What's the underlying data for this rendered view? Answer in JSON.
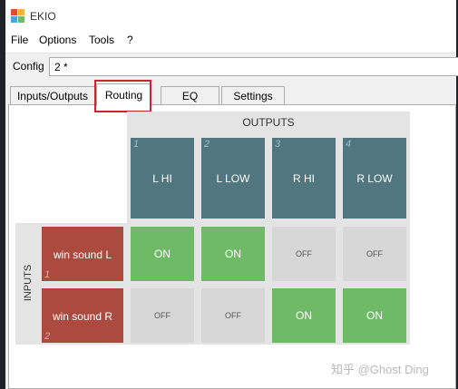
{
  "window": {
    "title": "EKIO",
    "icon": "ekio-app-icon"
  },
  "menu": [
    "File",
    "Options",
    "Tools",
    "?"
  ],
  "config": {
    "label": "Config",
    "value": "2 *"
  },
  "tabs": [
    "Inputs/Outputs",
    "Routing",
    "EQ",
    "Settings"
  ],
  "active_tab": "Routing",
  "routing": {
    "outputs_title": "OUTPUTS",
    "inputs_title": "INPUTS",
    "outputs": [
      {
        "num": "1",
        "label": "L HI"
      },
      {
        "num": "2",
        "label": "L LOW"
      },
      {
        "num": "3",
        "label": "R HI"
      },
      {
        "num": "4",
        "label": "R LOW"
      }
    ],
    "inputs": [
      {
        "num": "1",
        "label": "win sound L",
        "cells": [
          "ON",
          "ON",
          "OFF",
          "OFF"
        ]
      },
      {
        "num": "2",
        "label": "win sound R",
        "cells": [
          "OFF",
          "OFF",
          "ON",
          "ON"
        ]
      }
    ]
  },
  "colors": {
    "output": "#50777f",
    "input": "#ac4a40",
    "on": "#6fba66",
    "off": "#d7d7d7",
    "highlight": "#c8282d"
  },
  "watermark": "知乎 @Ghost Ding"
}
